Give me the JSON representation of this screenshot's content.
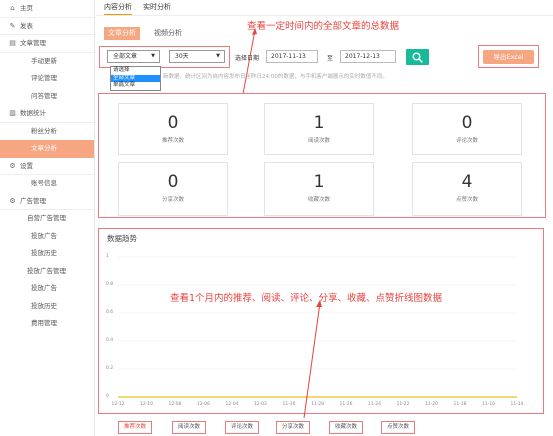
{
  "sidebar": {
    "items": [
      {
        "label": "主页",
        "icon": "home-icon",
        "glyph": "⌂",
        "kind": "main"
      },
      {
        "label": "发表",
        "icon": "edit-icon",
        "glyph": "✎",
        "kind": "main"
      },
      {
        "label": "文章管理",
        "icon": "document-icon",
        "glyph": "▤",
        "kind": "main"
      },
      {
        "label": "手动更新",
        "kind": "sub"
      },
      {
        "label": "评论管理",
        "kind": "sub"
      },
      {
        "label": "问答管理",
        "kind": "sub"
      },
      {
        "label": "数据统计",
        "icon": "bar-chart-icon",
        "glyph": "▥",
        "kind": "main"
      },
      {
        "label": "粉丝分析",
        "kind": "sub"
      },
      {
        "label": "文章分析",
        "kind": "sub",
        "active": true
      },
      {
        "label": "设置",
        "icon": "gear-icon",
        "glyph": "⚙",
        "kind": "main"
      },
      {
        "label": "账号信息",
        "kind": "sub"
      },
      {
        "label": "广告管理",
        "icon": "ad-gear-icon",
        "glyph": "⚙",
        "kind": "main"
      },
      {
        "label": "自营广告管理",
        "kind": "sub2"
      },
      {
        "label": "投放广告",
        "kind": "sub"
      },
      {
        "label": "投放历史",
        "kind": "sub"
      },
      {
        "label": "投放广告管理",
        "kind": "sub2"
      },
      {
        "label": "投放广告",
        "kind": "sub"
      },
      {
        "label": "投放历史",
        "kind": "sub"
      },
      {
        "label": "费用管理",
        "kind": "sub"
      }
    ]
  },
  "tabs": {
    "content_analysis": "内容分析",
    "realtime_analysis": "实时分析"
  },
  "subtabs": {
    "article_analysis": "文章分析",
    "video_analysis": "视频分析"
  },
  "filters": {
    "article_select": "全部文章",
    "article_options": [
      "请选择",
      "全部文章",
      "单篇文章"
    ],
    "article_selected_index": 1,
    "period_select": "30天",
    "date_label": "选择日期",
    "start_date": "2017-11-13",
    "to_label": "至",
    "end_date": "2017-12-13",
    "export_label": "导出Excel",
    "note": "新数据，统计区间为自内容发布日至昨日24:00的数据，与手机客户端展示的实时数值不同。"
  },
  "annotations": {
    "top": "查看一定时间内的全部文章的总数据",
    "chart": "查看1个月内的推荐、阅读、评论、分享、收藏、点赞折线图数据"
  },
  "stats": [
    {
      "value": "0",
      "label": "推荐次数"
    },
    {
      "value": "1",
      "label": "阅读次数"
    },
    {
      "value": "0",
      "label": "评论次数"
    },
    {
      "value": "0",
      "label": "分享次数"
    },
    {
      "value": "1",
      "label": "收藏次数"
    },
    {
      "value": "4",
      "label": "点赞次数"
    }
  ],
  "chart_data": {
    "type": "line",
    "title": "数据趋势",
    "yticks": [
      "1",
      "0.8",
      "0.6",
      "0.4",
      "0.2",
      "0"
    ],
    "ylim": [
      0,
      1
    ],
    "categories": [
      "12-12",
      "12-10",
      "12-08",
      "12-06",
      "12-04",
      "12-02",
      "11-30",
      "11-28",
      "11-26",
      "11-24",
      "11-22",
      "11-20",
      "11-18",
      "11-16",
      "11-14"
    ],
    "series": [
      {
        "name": "推荐次数",
        "values": [
          0,
          0,
          0,
          0,
          0,
          0,
          0,
          0,
          0,
          0,
          0,
          0,
          0,
          0,
          0
        ],
        "color": "#f5a57c"
      }
    ],
    "legend": [
      "推荐次数",
      "阅读次数",
      "评论次数",
      "分享次数",
      "收藏次数",
      "点赞次数"
    ]
  },
  "colors": {
    "accent": "#f7a682",
    "search": "#19b99b",
    "annotation": "#e8433d",
    "line": "#f2c94c"
  }
}
